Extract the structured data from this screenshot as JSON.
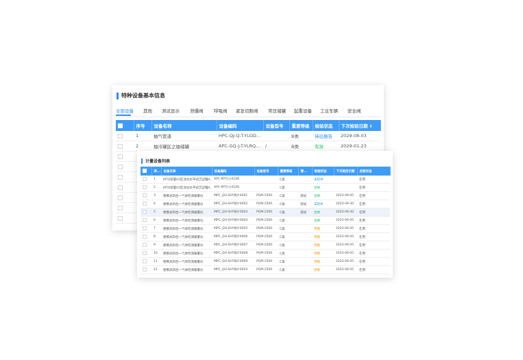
{
  "colors": {
    "accent": "#2d8cf0",
    "header_bg": "#3e9cf7",
    "status_blue": "#2d8cf0",
    "status_green": "#19be6b",
    "status_orange": "#f0a020"
  },
  "back": {
    "title": "特种设备基本信息",
    "tabs": [
      "全部设备",
      "其他",
      "测试显示",
      "泄爆阀",
      "呼吸阀",
      "紧急切断阀",
      "常压储罐",
      "起重设备",
      "工业车辆",
      "安全阀"
    ],
    "active_tab": 0,
    "columns": [
      "序号",
      "设备名称",
      "设备编码",
      "设备型号",
      "重要等级",
      "检验状态",
      "下次检验日期"
    ],
    "rows": [
      [
        "1",
        "抽气管道",
        "HPC-QJ-Q-T-YLGD...",
        "",
        "B类",
        "待出报告",
        "2029-08-03"
      ],
      [
        "2",
        "抽冷罐区之抽储罐",
        "APC-GQ-J-T-YLRQ...",
        "/",
        "B类",
        "有效",
        "2029-01-23"
      ]
    ]
  },
  "front": {
    "title": "计量设备列表",
    "columns": [
      "序...",
      "设备名称",
      "设备编码",
      "设备型号",
      "重要等级",
      "管...",
      "检验状态",
      "下次检定日期",
      "启检状态"
    ],
    "rows": [
      [
        "1",
        "MTO装置03区净化水平式沉淀罐A...",
        "APC-MTO-J-0108",
        "",
        "C类",
        "",
        "未检中",
        "",
        "在用"
      ],
      [
        "2",
        "MTO装置03区净化水平式沉淀罐A...",
        "APC-MTO-J-0109",
        "",
        "C类",
        "",
        "合格",
        "",
        "在用"
      ],
      [
        "3",
        "便携式四合一气体检测报警仪",
        "MPC_QH-SHYBJY-0001",
        "PGM-2500",
        "C类",
        "测试",
        "合格",
        "2023-06-05",
        "在用"
      ],
      [
        "4",
        "便携式四合一气体检测报警仪",
        "MPC_QH-SHYBJY-0002",
        "PGM-2500",
        "C类",
        "测试",
        "未检中",
        "2023-09-30",
        "在用"
      ],
      [
        "5",
        "便携式四合一气体检测报警仪",
        "MPC_QH-SHYBJY-0003",
        "PGM-2500",
        "C类",
        "测试",
        "合格",
        "2023-09-30",
        "在用"
      ],
      [
        "6",
        "便携式四合一气体检测报警仪",
        "MPC_QH-SHYBJY-0004",
        "PGM-2500",
        "C类",
        "",
        "合格",
        "2023-06-05",
        "在用"
      ],
      [
        "7",
        "便携式四合一气体检测报警仪",
        "MPC_QH-SHYBJY-0005",
        "PGM-2500",
        "C类",
        "",
        "预警",
        "2023-06-05",
        "在用"
      ],
      [
        "8",
        "便携式四合一气体检测报警仪",
        "MPC_QH-SHYBJY-0006",
        "PGM-2500",
        "C类",
        "",
        "预警",
        "2023-06-05",
        "在用"
      ],
      [
        "9",
        "便携式四合一气体检测报警仪",
        "MPC_QH-SHYBJY-0007",
        "PGM-2500",
        "C类",
        "",
        "预警",
        "2023-06-05",
        "在用"
      ],
      [
        "10",
        "便携式四合一气体检测报警仪",
        "MPC_QH-SHYBJY-0008",
        "PGM-2500",
        "C类",
        "",
        "预警",
        "2023-06-05",
        "在用"
      ],
      [
        "11",
        "便携式四合一气体检测报警仪",
        "MPC_QH-SHYBJY-0009",
        "PGM-2500",
        "C类",
        "",
        "预警",
        "2023-06-05",
        "在用"
      ],
      [
        "12",
        "便携式四合一气体检测报警仪",
        "MPC_QH-SHYBJY-0010",
        "PGM-2500",
        "C类",
        "",
        "预警",
        "2023-06-05",
        "在用"
      ]
    ],
    "highlighted_row": 4
  }
}
